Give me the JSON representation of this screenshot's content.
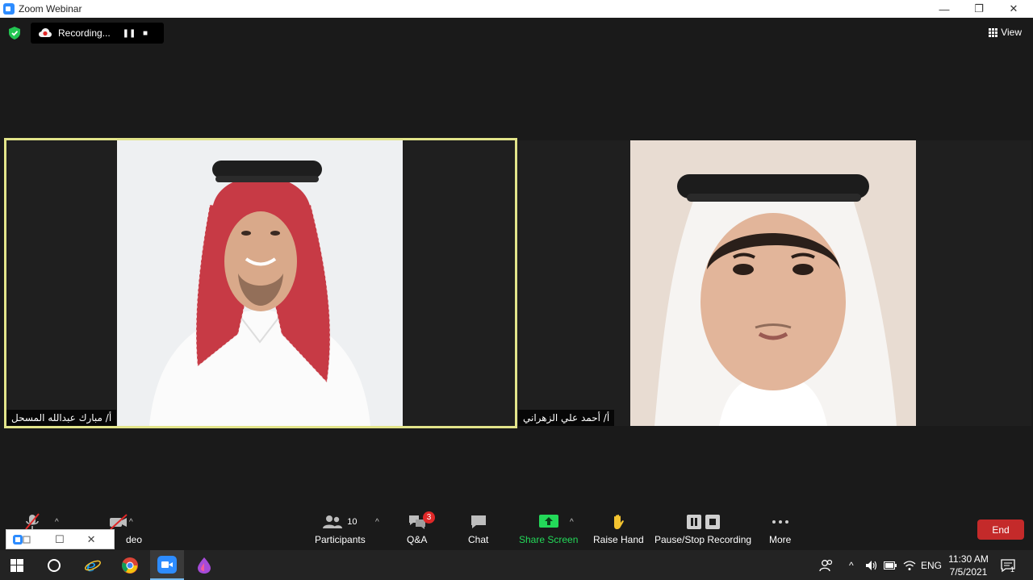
{
  "window": {
    "title": "Zoom Webinar",
    "minimize_glyph": "—",
    "restore_glyph": "❐",
    "close_glyph": "✕"
  },
  "topbar": {
    "recording_label": "Recording...",
    "pause_glyph": "❚❚",
    "stop_glyph": "■",
    "view_label": "View"
  },
  "participants": [
    {
      "name": "أ/ مبارك عبدالله المسحل",
      "active_speaker": true
    },
    {
      "name": "أ/ أحمد علي الزهراني",
      "active_speaker": false
    }
  ],
  "toolbar": {
    "video_label": "deo",
    "participants_label": "Participants",
    "participants_count": "10",
    "qa_label": "Q&A",
    "qa_badge": "3",
    "chat_label": "Chat",
    "share_label": "Share Screen",
    "raise_hand_label": "Raise Hand",
    "recording_label": "Pause/Stop Recording",
    "more_label": "More",
    "end_label": "End",
    "caret_glyph": "^"
  },
  "colors": {
    "share_green": "#23d959",
    "end_red": "#c42a2a",
    "active_border": "#e2e48a"
  },
  "taskbar": {
    "language": "ENG",
    "time": "11:30 AM",
    "date": "7/5/2021",
    "notification_count": "1",
    "tray_caret_glyph": "^"
  }
}
